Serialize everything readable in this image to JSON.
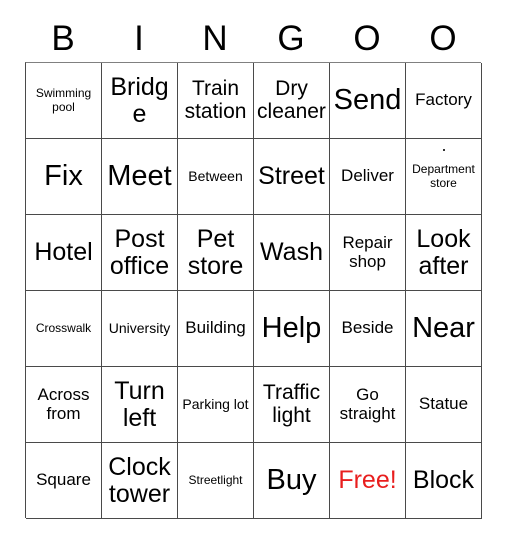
{
  "card": {
    "title": "BINGOO",
    "header_letters": [
      "B",
      "I",
      "N",
      "G",
      "O",
      "O"
    ],
    "free_color": "#e81e1e",
    "text_color": "#000000",
    "grid_line_color": "#4a4a4a",
    "background_color": "#ffffff",
    "columns": 6,
    "rows": 6,
    "cells": [
      [
        {
          "label": "Swimming pool",
          "size": "fs-xs",
          "free": false
        },
        {
          "label": "Bridge",
          "size": "fs-xl",
          "free": false
        },
        {
          "label": "Train station",
          "size": "fs-lg",
          "free": false
        },
        {
          "label": "Dry cleaner",
          "size": "fs-lg",
          "free": false
        },
        {
          "label": "Send",
          "size": "fs-xxl",
          "free": false
        },
        {
          "label": "Factory",
          "size": "fs-md",
          "free": false
        }
      ],
      [
        {
          "label": "Fix",
          "size": "fs-xxl",
          "free": false
        },
        {
          "label": "Meet",
          "size": "fs-xxl",
          "free": false
        },
        {
          "label": "Between",
          "size": "fs-sm",
          "free": false
        },
        {
          "label": "Street",
          "size": "fs-xl",
          "free": false
        },
        {
          "label": "Deliver",
          "size": "fs-md",
          "free": false
        },
        {
          "label": "Department store",
          "size": "fs-xs",
          "free": false,
          "stray_dot": true
        }
      ],
      [
        {
          "label": "Hotel",
          "size": "fs-xl",
          "free": false
        },
        {
          "label": "Post office",
          "size": "fs-xl",
          "free": false
        },
        {
          "label": "Pet store",
          "size": "fs-xl",
          "free": false
        },
        {
          "label": "Wash",
          "size": "fs-xl",
          "free": false
        },
        {
          "label": "Repair shop",
          "size": "fs-md",
          "free": false
        },
        {
          "label": "Look after",
          "size": "fs-xl",
          "free": false
        }
      ],
      [
        {
          "label": "Crosswalk",
          "size": "fs-xs",
          "free": false
        },
        {
          "label": "University",
          "size": "fs-sm",
          "free": false
        },
        {
          "label": "Building",
          "size": "fs-md",
          "free": false
        },
        {
          "label": "Help",
          "size": "fs-xxl",
          "free": false
        },
        {
          "label": "Beside",
          "size": "fs-md",
          "free": false
        },
        {
          "label": "Near",
          "size": "fs-xxl",
          "free": false
        }
      ],
      [
        {
          "label": "Across from",
          "size": "fs-md",
          "free": false
        },
        {
          "label": "Turn left",
          "size": "fs-xl",
          "free": false
        },
        {
          "label": "Parking lot",
          "size": "fs-sm",
          "free": false
        },
        {
          "label": "Traffic light",
          "size": "fs-lg",
          "free": false
        },
        {
          "label": "Go straight",
          "size": "fs-md",
          "free": false
        },
        {
          "label": "Statue",
          "size": "fs-md",
          "free": false
        }
      ],
      [
        {
          "label": "Square",
          "size": "fs-md",
          "free": false
        },
        {
          "label": "Clock tower",
          "size": "fs-xl",
          "free": false
        },
        {
          "label": "Streetlight",
          "size": "fs-xs",
          "free": false
        },
        {
          "label": "Buy",
          "size": "fs-xxl",
          "free": false
        },
        {
          "label": "Free!",
          "size": "fs-xl",
          "free": true
        },
        {
          "label": "Block",
          "size": "fs-xl",
          "free": false
        }
      ]
    ]
  }
}
